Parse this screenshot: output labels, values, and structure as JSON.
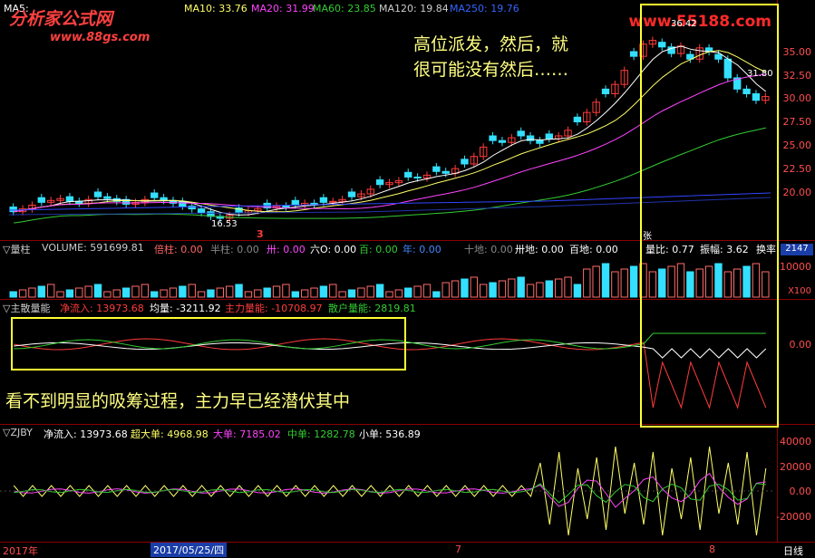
{
  "main_header": {
    "ma5_label": "MA5:",
    "ma10": "MA10: 33.76",
    "ma20": "MA20: 31.99",
    "ma60": "MA60: 23.85",
    "ma120": "MA120: 19.84",
    "ma250": "MA250: 19.76"
  },
  "logo": {
    "title": "分析家公式网",
    "url": "www.88gs.com",
    "watermark": "www.55188.com"
  },
  "price_axis": [
    "35.00",
    "32.50",
    "30.00",
    "27.50",
    "25.00",
    "22.50",
    "20.00"
  ],
  "price_marks": {
    "high": "36.42",
    "low": "16.53",
    "last": "31.80",
    "day_marker": "3",
    "flag": "张"
  },
  "annotation_top": {
    "line1": "高位派发，然后，就",
    "line2": "很可能没有然后……"
  },
  "annotation_mid": "看不到明显的吸筹过程，主力早已经潜伏其中",
  "volume_header": {
    "title": "▽量柱",
    "volume": "VOLUME: 591699.81",
    "beizhu": "倍柱: 0.00",
    "banzhu": "半柱: 0.00",
    "zhu": "卅: 0.00",
    "liu": "六O: 0.00",
    "bai": "百: 0.00",
    "nian": "年: 0.00",
    "shidi": "十地: 0.00",
    "sadi": "卅地: 0.00",
    "baidi": "百地: 0.00",
    "liangbi": "量比: 0.77",
    "zhenfu": "振幅: 3.62",
    "huanlv": "换率",
    "num": "2147"
  },
  "volume_axis": {
    "top": "10000",
    "unit": "X100"
  },
  "energy_header": {
    "title": "▽主散量能",
    "net": "净流入: 13973.68",
    "avg": "均量: -3211.92",
    "main": "主力量能: -10708.97",
    "retail": "散户量能: 2819.81"
  },
  "energy_axis": "0.00",
  "zjby_header": {
    "title": "▽ZJBY",
    "net": "净流入: 13973.68",
    "super": "超大单: 4968.98",
    "big": "大单: 7185.02",
    "mid": "中单: 1282.78",
    "small": "小单: 536.89"
  },
  "zjby_axis": [
    "40000",
    "20000",
    "0.00",
    "-20000"
  ],
  "bottom_bar": {
    "year": "2017年",
    "date": "2017/05/25/四",
    "m7": "7",
    "m8": "8",
    "period": "日线"
  },
  "colors": {
    "up": "#ff3b3b",
    "down": "#33e0ff",
    "ma5": "#ffffff",
    "ma10": "#ffff66",
    "ma20": "#ff44ff",
    "ma60": "#33cc33",
    "ma120": "#3344ff",
    "highlight": "#ffff33"
  }
}
